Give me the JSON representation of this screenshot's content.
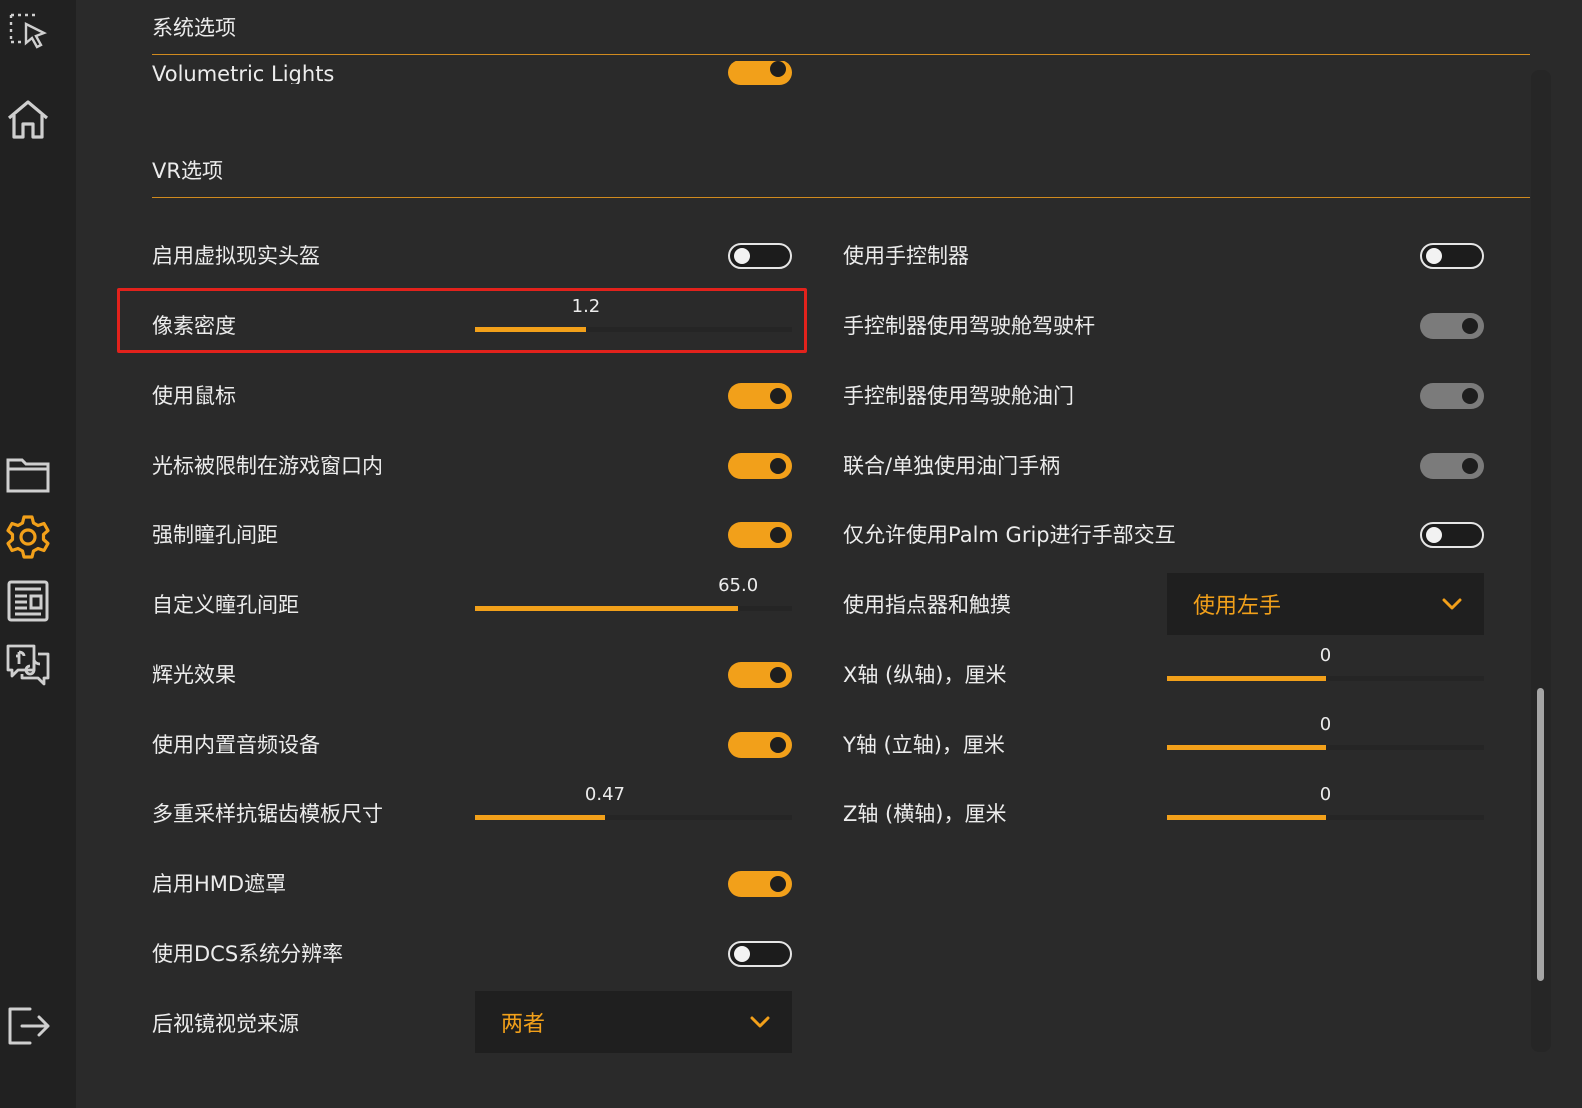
{
  "sections": {
    "system": "系统选项",
    "partial_item": "Volumetric Lights",
    "vr": "VR选项"
  },
  "left": {
    "enable_headset": "启用虚拟现实头盔",
    "pixel_density": {
      "label": "像素密度",
      "value": "1.2",
      "fraction": 0.35
    },
    "use_mouse": "使用鼠标",
    "cursor_confined": "光标被限制在游戏窗口内",
    "force_ipd": "强制瞳孔间距",
    "custom_ipd": {
      "label": "自定义瞳孔间距",
      "value": "65.0",
      "fraction": 0.83
    },
    "bloom": "辉光效果",
    "builtin_audio": "使用内置音频设备",
    "msaa_mask": {
      "label": "多重采样抗锯齿模板尺寸",
      "value": "0.47",
      "fraction": 0.41
    },
    "hmd_mask": "启用HMD遮罩",
    "dcs_resolution": "使用DCS系统分辨率",
    "mirror_source": {
      "label": "后视镜视觉来源",
      "value": "两者"
    }
  },
  "right": {
    "hand_controllers": "使用手控制器",
    "cockpit_stick": "手控制器使用驾驶舱驾驶杆",
    "cockpit_throttle": "手控制器使用驾驶舱油门",
    "throttle_combined": "联合/单独使用油门手柄",
    "palm_grip": "仅允许使用Palm Grip进行手部交互",
    "pointer_touch": {
      "label": "使用指点器和触摸",
      "value": "使用左手"
    },
    "x_axis": {
      "label": "X轴 (纵轴)，厘米",
      "value": "0",
      "fraction": 0.5
    },
    "y_axis": {
      "label": "Y轴 (立轴)，厘米",
      "value": "0",
      "fraction": 0.5
    },
    "z_axis": {
      "label": "Z轴 (横轴)，厘米",
      "value": "0",
      "fraction": 0.5
    }
  },
  "toggles": {
    "volumetric_lights": "on",
    "enable_headset": "off",
    "use_mouse": "on",
    "cursor_confined": "on",
    "force_ipd": "on",
    "bloom": "on",
    "builtin_audio": "on",
    "hmd_mask": "on",
    "dcs_resolution": "off",
    "hand_controllers": "off",
    "cockpit_stick": "gray",
    "cockpit_throttle": "gray",
    "throttle_combined": "gray",
    "palm_grip": "off"
  },
  "colors": {
    "accent": "#f2a01a",
    "highlight": "#e2221c",
    "background": "#2a2a2a",
    "sidebar": "#212121"
  },
  "icons": {
    "sidebar": [
      "select-cursor-icon",
      "home-icon",
      "folder-icon",
      "gear-icon",
      "news-icon",
      "social-icon",
      "logout-icon"
    ]
  }
}
